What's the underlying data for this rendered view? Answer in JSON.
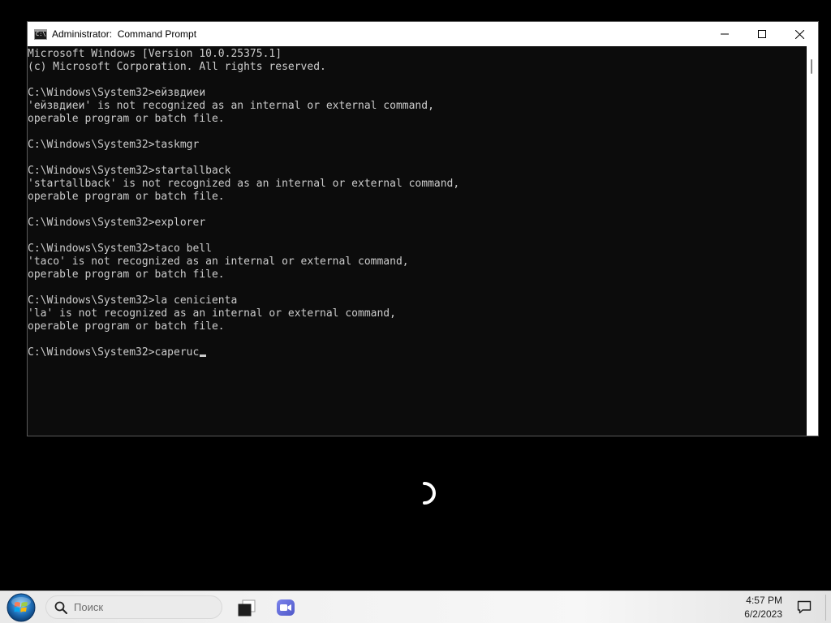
{
  "window": {
    "title": "Administrator:  Command Prompt",
    "minimize_label": "Minimize",
    "maximize_label": "Maximize",
    "close_label": "Close"
  },
  "console": {
    "lines": [
      "Microsoft Windows [Version 10.0.25375.1]",
      "(c) Microsoft Corporation. All rights reserved.",
      "",
      "C:\\Windows\\System32>ейзвдиеи",
      "'ейзвдиеи' is not recognized as an internal or external command,",
      "operable program or batch file.",
      "",
      "C:\\Windows\\System32>taskmgr",
      "",
      "C:\\Windows\\System32>startallback",
      "'startallback' is not recognized as an internal or external command,",
      "operable program or batch file.",
      "",
      "C:\\Windows\\System32>explorer",
      "",
      "C:\\Windows\\System32>taco bell",
      "'taco' is not recognized as an internal or external command,",
      "operable program or batch file.",
      "",
      "C:\\Windows\\System32>la cenicienta",
      "'la' is not recognized as an internal or external command,",
      "operable program or batch file.",
      "",
      "C:\\Windows\\System32>caperuc"
    ]
  },
  "taskbar": {
    "search_placeholder": "Поиск",
    "time": "4:57 PM",
    "date": "6/2/2023",
    "icons": [
      "start-orb-icon",
      "search-icon",
      "task-view-icon",
      "chat-icon",
      "notification-icon"
    ]
  },
  "colors": {
    "console_bg": "#0c0c0c",
    "console_text": "#cccccc",
    "desktop_bg": "#000000",
    "titlebar_bg": "#ffffff"
  }
}
